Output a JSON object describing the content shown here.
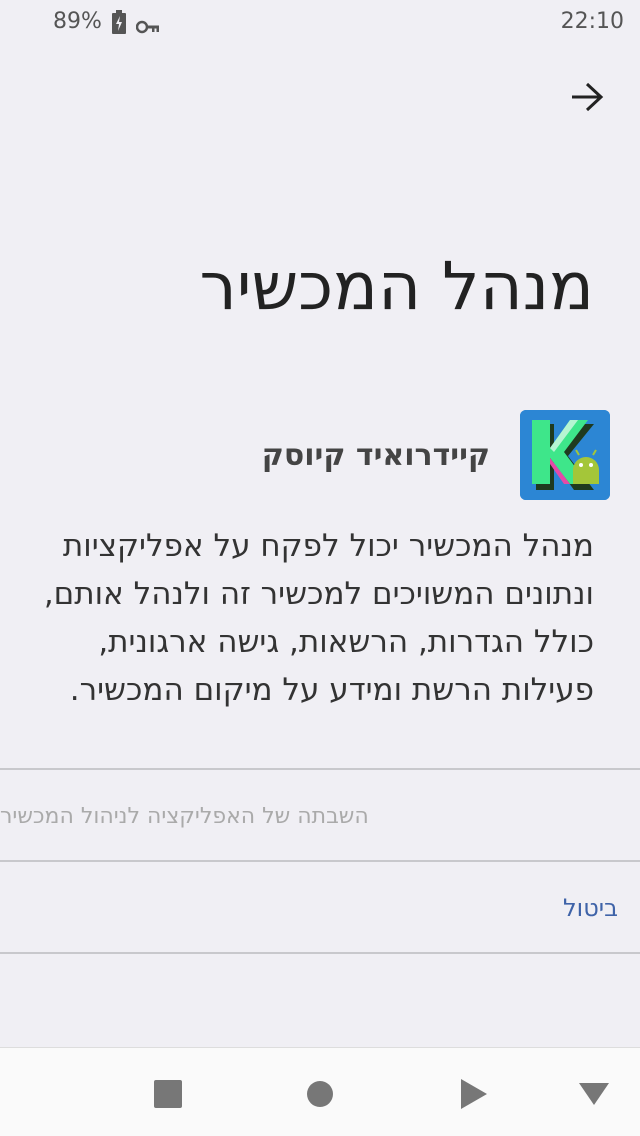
{
  "status_bar": {
    "battery_percent": "89%",
    "time": "22:10",
    "battery_icon": "battery-charging-icon",
    "vpn_icon": "key-icon"
  },
  "header": {
    "back_icon": "arrow-right-icon"
  },
  "page": {
    "title": "מנהל המכשיר",
    "app_name": "קיידרואיד קיוסק",
    "app_icon": "kiosk-app-icon",
    "description": "מנהל המכשיר יכול לפקח על אפליקציות ונתונים המשויכים למכשיר זה ולנהל אותם, כולל הגדרות, הרשאות, גישה ארגונית, פעילות הרשת ומידע על מיקום המכשיר."
  },
  "actions": {
    "disable_label": "השבתה של האפליקציה לניהול המכשיר",
    "cancel_label": "ביטול"
  },
  "navigation_bar": {
    "buttons": [
      "recents-icon",
      "home-icon",
      "back-icon",
      "hide-keyboard-icon"
    ]
  },
  "colors": {
    "background": "#f0eff4",
    "accent": "#3f63a8",
    "app_icon_bg": "#2c86d4"
  }
}
